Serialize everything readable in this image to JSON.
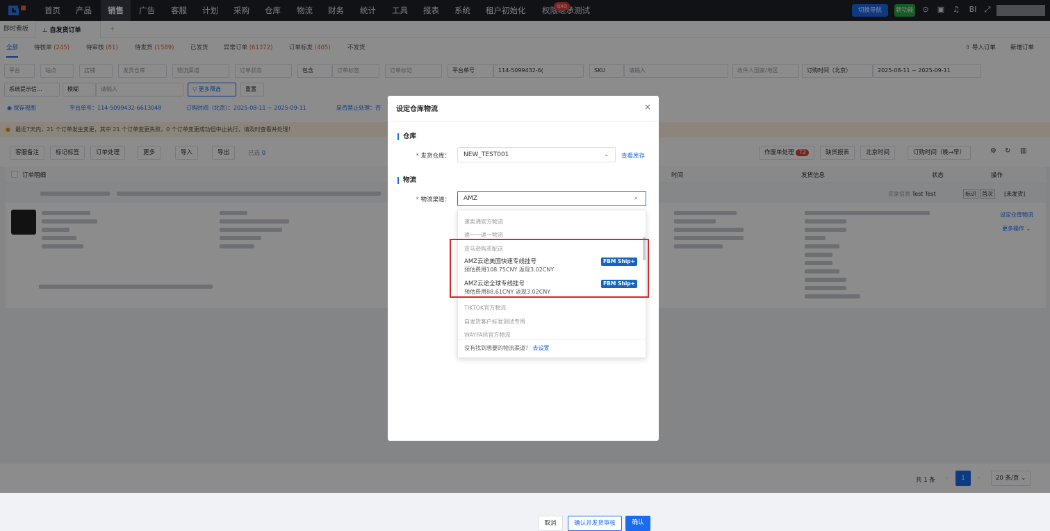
{
  "topnav": {
    "items": [
      "首页",
      "产品",
      "销售",
      "广告",
      "客服",
      "计划",
      "采购",
      "仓库",
      "物流",
      "财务",
      "统计",
      "工具",
      "报表",
      "系统",
      "租户初始化",
      "权限继承测试"
    ],
    "active_index": 2,
    "badge": "qxq",
    "switch_nav": "切换导航",
    "new_feature": "新功能",
    "bi_label": "BI"
  },
  "tabs": {
    "first": "即时看板",
    "active": "自发货订单",
    "add": "+"
  },
  "status_tabs": [
    {
      "label": "全部",
      "count": ""
    },
    {
      "label": "待核单",
      "count": "(245)"
    },
    {
      "label": "待审核",
      "count": "(81)"
    },
    {
      "label": "待发货",
      "count": "(1589)"
    },
    {
      "label": "已发货",
      "count": ""
    },
    {
      "label": "异常订单",
      "count": "(61372)"
    },
    {
      "label": "订单标发",
      "count": "(405)"
    },
    {
      "label": "不发货",
      "count": ""
    }
  ],
  "top_actions": {
    "import": "导入订单",
    "create": "新增订单"
  },
  "filters": {
    "row1": [
      "平台",
      "站点",
      "店铺",
      "发货仓库",
      "物流渠道",
      "订单状态"
    ],
    "contains": "包含",
    "order_tag": "订单标签",
    "order_mark": "订单标记",
    "platform_no": "平台单号",
    "platform_no_value": "114-5099432-6(",
    "sku": "SKU",
    "sku_placeholder": "请输入",
    "region": "收件人国家/地区",
    "order_time": "订购时间（北京）",
    "date_start": "2025-08-11",
    "date_sep": "~",
    "date_end": "2025-09-11",
    "sys_tip": "系统提示信...",
    "fuzzy": "模糊",
    "input_placeholder": "请输入",
    "more_filter": "更多筛选",
    "reset": "重置"
  },
  "chips": {
    "save_view": "保存视图",
    "chip1": "平台单号：114-5099432-6613048",
    "chip2": "订购时间（北京）：2025-08-11 ~ 2025-09-11",
    "chip3": "是否禁止处理：否"
  },
  "warning": {
    "text": "最近7天内，21 个订单发生变更，其中 21 个订单变更失败，0 个订单变更成功但中止执行，请及时查看并处理！"
  },
  "toolbar": {
    "left": [
      "客服备注",
      "标记标签",
      "订单处理",
      "更多",
      "导入",
      "导出"
    ],
    "selected": "已选",
    "selected_count": "0",
    "pending_label": "作废单处理",
    "pending_count": "72",
    "stock_report": "缺货报表",
    "timezone": "北京时间",
    "sort": "订购时间（晚→早）"
  },
  "table": {
    "headers": {
      "detail": "订单明细",
      "time": "时间",
      "ship_info": "发货信息",
      "status": "状态",
      "ops": "操作"
    },
    "row": {
      "buyer": "Test Test",
      "tag1": "标识",
      "tag2": "首次",
      "status_tag": "[未发货]",
      "op1": "设定仓库物流",
      "op2": "更多操作"
    }
  },
  "modal": {
    "title": "设定仓库物流",
    "warehouse_section": "仓库",
    "warehouse_label": "发货仓库：",
    "warehouse_value": "NEW_TEST001",
    "view_stock": "查看库存",
    "logistics_section": "物流",
    "channel_label": "物流渠道：",
    "channel_value": "AMZ",
    "dropdown": {
      "group1": "速卖通官方物流",
      "group2": "速一一速一物流",
      "group3": "亚马逊购买配送",
      "opt1_name": "AMZ云途美国快速专线挂号",
      "opt1_fee": "预估费用108.75CNY 返现3.02CNY",
      "opt1_tag": "FBM Ship+",
      "opt2_name": "AMZ云途全球专线挂号",
      "opt2_fee": "预估费用88.61CNY 返现3.02CNY",
      "opt2_tag": "FBM Ship+",
      "group4": "TIKTOK官方物流",
      "group5": "自发货客户标发测试专用",
      "group6": "WAYFAIR官方物流",
      "footer_text": "没有找到想要的物流渠道？",
      "footer_link": "去设置"
    },
    "btn_cancel": "取消",
    "btn_confirm_ship": "确认并发货审核",
    "btn_confirm": "确认"
  },
  "pagination": {
    "total": "共 1 条",
    "current": "1",
    "page_size": "20 条/页"
  },
  "colors": {
    "primary": "#1a6bf0",
    "topbar": "#1f2129",
    "danger": "#d42828",
    "fbm": "#1565c0"
  }
}
